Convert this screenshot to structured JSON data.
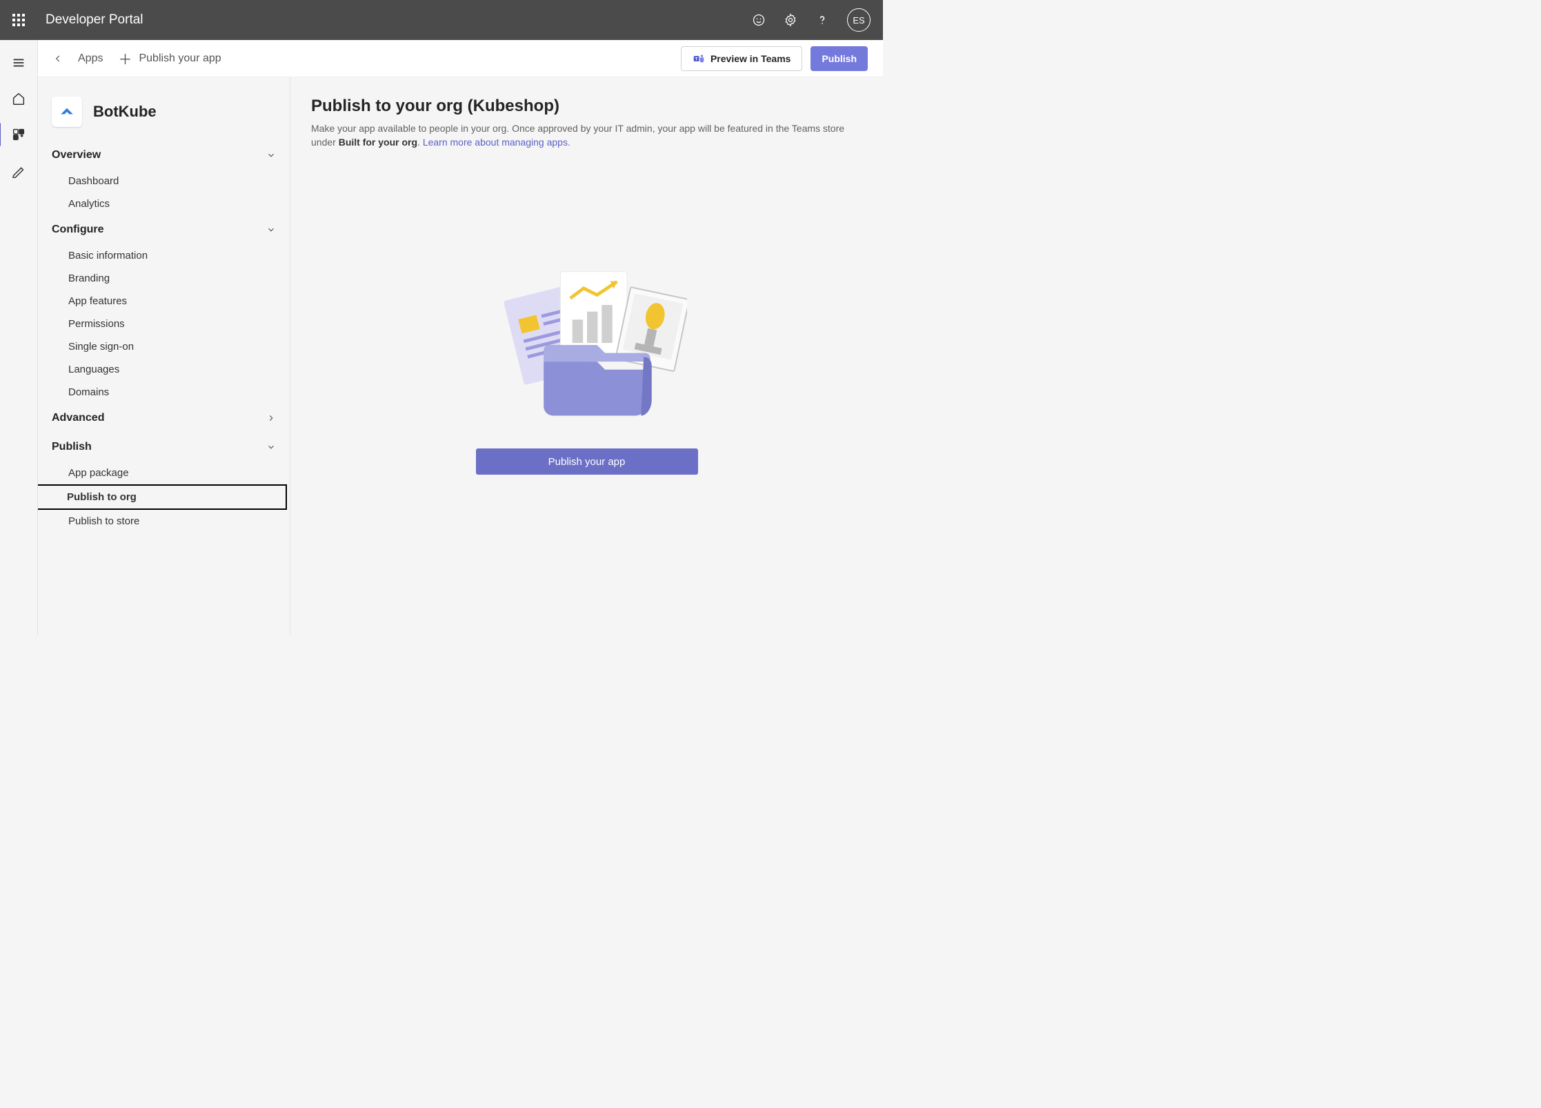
{
  "header": {
    "title": "Developer Portal",
    "avatar_initials": "ES"
  },
  "subheader": {
    "back_label": "Apps",
    "crumb_current": "Publish your app",
    "preview_label": "Preview in Teams",
    "publish_label": "Publish"
  },
  "sidebar": {
    "app_name": "BotKube",
    "sections": {
      "overview": {
        "label": "Overview",
        "items": [
          "Dashboard",
          "Analytics"
        ]
      },
      "configure": {
        "label": "Configure",
        "items": [
          "Basic information",
          "Branding",
          "App features",
          "Permissions",
          "Single sign-on",
          "Languages",
          "Domains"
        ]
      },
      "advanced": {
        "label": "Advanced"
      },
      "publish": {
        "label": "Publish",
        "items": [
          "App package",
          "Publish to org",
          "Publish to store"
        ]
      }
    }
  },
  "main": {
    "title": "Publish to your org (Kubeshop)",
    "desc_1": "Make your app available to people in your org. Once approved by your IT admin, your app will be featured in the Teams store under ",
    "desc_bold": "Built for your org",
    "desc_2": ". ",
    "link": "Learn more about managing apps.",
    "cta": "Publish your app"
  }
}
